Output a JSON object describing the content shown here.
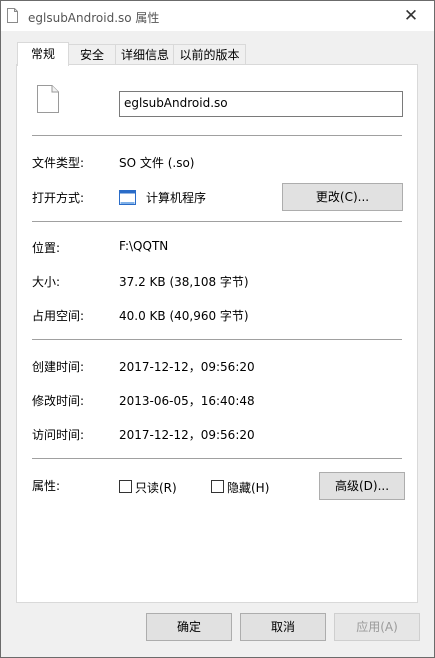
{
  "window": {
    "title": "eglsubAndroid.so 属性",
    "close_glyph": "✕"
  },
  "tabs": [
    {
      "label": "常规",
      "active": true
    },
    {
      "label": "安全",
      "active": false
    },
    {
      "label": "详细信息",
      "active": false
    },
    {
      "label": "以前的版本",
      "active": false
    }
  ],
  "general": {
    "file_name": "eglsubAndroid.so",
    "type_label": "文件类型:",
    "type_value": "SO 文件 (.so)",
    "opens_with_label": "打开方式:",
    "opens_with_value": "计算机程序",
    "change_button": "更改(C)...",
    "location_label": "位置:",
    "location_value": "F:\\QQTN",
    "size_label": "大小:",
    "size_value": "37.2 KB (38,108 字节)",
    "size_on_disk_label": "占用空间:",
    "size_on_disk_value": "40.0 KB (40,960 字节)",
    "created_label": "创建时间:",
    "created_value": "2017-12-12，09:56:20",
    "modified_label": "修改时间:",
    "modified_value": "2013-06-05，16:40:48",
    "accessed_label": "访问时间:",
    "accessed_value": "2017-12-12，09:56:20",
    "attributes_label": "属性:",
    "readonly_label": "只读(R)",
    "readonly_checked": false,
    "hidden_label": "隐藏(H)",
    "hidden_checked": false,
    "advanced_button": "高级(D)..."
  },
  "footer": {
    "ok_button": "确定",
    "cancel_button": "取消",
    "apply_button": "应用(A)"
  },
  "icons": {
    "title": "file-icon",
    "file": "file-icon",
    "program": "program-window-icon",
    "close": "close-icon"
  }
}
